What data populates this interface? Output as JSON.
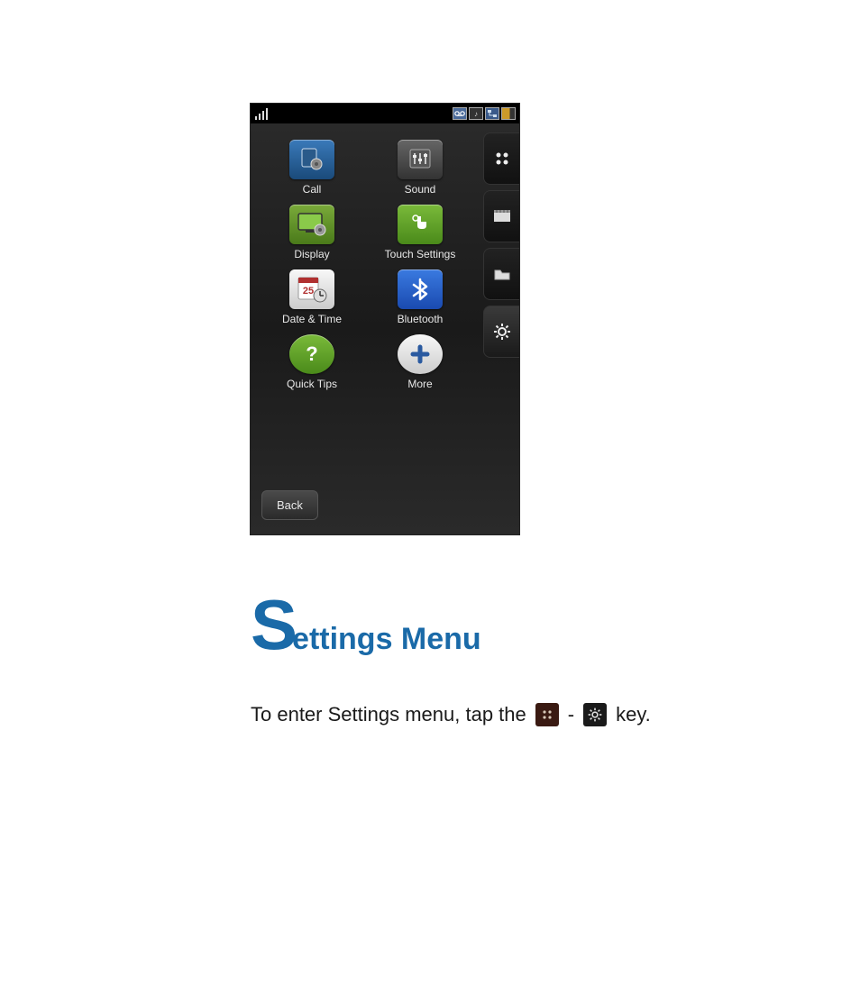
{
  "heading": {
    "capital": "S",
    "rest": "ettings Menu"
  },
  "instruction": {
    "pre": "To enter Settings menu, tap the",
    "sep": "-",
    "post": "key."
  },
  "phone": {
    "back_label": "Back",
    "apps": [
      {
        "label": "Call",
        "icon": "call-icon"
      },
      {
        "label": "Sound",
        "icon": "sound-icon"
      },
      {
        "label": "Display",
        "icon": "display-icon"
      },
      {
        "label": "Touch Settings",
        "icon": "touch-settings-icon"
      },
      {
        "label": "Date & Time",
        "icon": "date-time-icon"
      },
      {
        "label": "Bluetooth",
        "icon": "bluetooth-icon"
      },
      {
        "label": "Quick Tips",
        "icon": "quick-tips-icon"
      },
      {
        "label": "More",
        "icon": "more-icon"
      }
    ],
    "side_tabs": [
      {
        "name": "apps-grid-tab",
        "active": false
      },
      {
        "name": "media-tab",
        "active": false
      },
      {
        "name": "files-tab",
        "active": false
      },
      {
        "name": "settings-tab",
        "active": true
      }
    ],
    "status": {
      "left": [
        "signal-icon"
      ],
      "right": [
        "voicemail-icon",
        "music-icon",
        "network-icon",
        "battery-icon"
      ]
    }
  }
}
